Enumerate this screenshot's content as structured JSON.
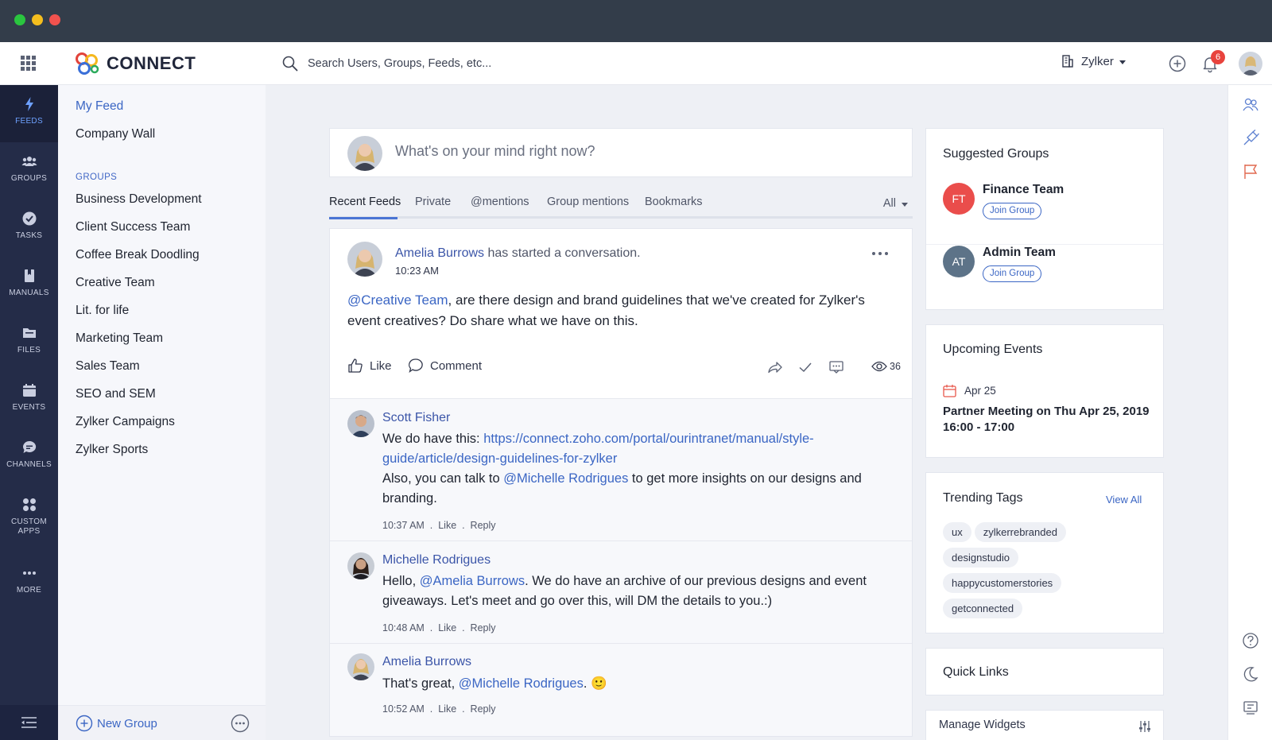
{
  "app": {
    "name": "CONNECT"
  },
  "search": {
    "placeholder": "Search Users, Groups, Feeds, etc..."
  },
  "header": {
    "org_name": "Zylker",
    "notification_count": "6"
  },
  "leftnav": [
    {
      "label": "FEEDS",
      "icon": "lightning-icon"
    },
    {
      "label": "GROUPS",
      "icon": "groups-icon"
    },
    {
      "label": "TASKS",
      "icon": "check-circle-icon"
    },
    {
      "label": "MANUALS",
      "icon": "book-icon"
    },
    {
      "label": "FILES",
      "icon": "folder-icon"
    },
    {
      "label": "EVENTS",
      "icon": "calendar-icon"
    },
    {
      "label": "CHANNELS",
      "icon": "chat-bubble-icon"
    },
    {
      "label": "CUSTOM",
      "label2": "APPS",
      "icon": "apps-icon"
    },
    {
      "label": "MORE",
      "icon": "more-dots-icon"
    }
  ],
  "sidebar": {
    "my_feed": "My Feed",
    "company_wall": "Company Wall",
    "groups_heading": "GROUPS",
    "groups": [
      "Business Development",
      "Client Success Team",
      "Coffee Break Doodling",
      "Creative Team",
      "Lit. for life",
      "Marketing Team",
      "Sales Team",
      "SEO and SEM",
      "Zylker Campaigns",
      "Zylker Sports"
    ],
    "new_group": "New Group"
  },
  "composer": {
    "placeholder": "What's on your mind right now?"
  },
  "tabs": {
    "items": [
      "Recent Feeds",
      "Private",
      "@mentions",
      "Group mentions",
      "Bookmarks"
    ],
    "filter": "All"
  },
  "post": {
    "author": "Amelia Burrows",
    "action": "has started a conversation.",
    "time": "10:23 AM",
    "mention": "@Creative Team",
    "body": ", are there design and brand guidelines that we've created for Zylker's event creatives? Do share what we have on this.",
    "like_label": "Like",
    "comment_label": "Comment",
    "views": "36"
  },
  "comments": [
    {
      "author": "Scott Fisher",
      "text1": "We do have this: ",
      "link": "https://connect.zoho.com/portal/ourintranet/manual/style-guide/article/design-guidelines-for-zylker",
      "text2": "Also, you can talk to ",
      "mention": "@Michelle Rodrigues",
      "text3": " to get more insights on our designs and branding.",
      "time": "10:37 AM"
    },
    {
      "author": "Michelle Rodrigues",
      "text1": "Hello, ",
      "mention": "@Amelia Burrows",
      "text2": ". We do have an archive of our previous designs and event giveaways. Let's meet and go over this, will DM the details to you.:)",
      "time": "10:48 AM"
    },
    {
      "author": "Amelia Burrows",
      "text1": "That's great, ",
      "mention": "@Michelle Rodrigues",
      "text2": ".",
      "emoji": "🙂",
      "time": "10:52 AM"
    }
  ],
  "comment_meta": {
    "sep": ".",
    "like": "Like",
    "reply": "Reply"
  },
  "suggested_groups": {
    "title": "Suggested Groups",
    "items": [
      {
        "initials": "FT",
        "name": "Finance Team",
        "color": "#ea4d4b",
        "join": "Join Group"
      },
      {
        "initials": "AT",
        "name": "Admin Team",
        "color": "#5d7388",
        "join": "Join Group"
      }
    ]
  },
  "events": {
    "title": "Upcoming Events",
    "date": "Apr 25",
    "event_title": "Partner Meeting on Thu Apr 25, 2019 16:00 - 17:00"
  },
  "trending": {
    "title": "Trending Tags",
    "view_all": "View All",
    "tags": [
      "ux",
      "zylkerrebranded",
      "designstudio",
      "happycustomerstories",
      "getconnected"
    ]
  },
  "quick_links": {
    "title": "Quick Links"
  },
  "manage_widgets": {
    "title": "Manage Widgets"
  },
  "colors": {
    "accent": "#3b66c4",
    "nav_bg": "#242c48",
    "chrome": "#333d4a"
  }
}
